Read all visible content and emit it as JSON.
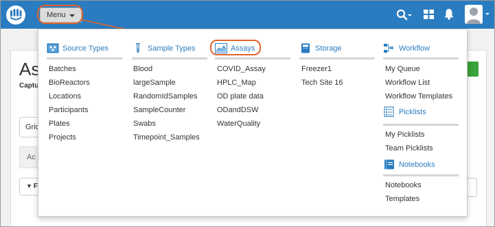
{
  "topbar": {
    "menu_label": "Menu"
  },
  "background": {
    "title_fragment": "As",
    "subtitle_fragment": "Captu",
    "input_fragment": "Grid",
    "tab_fragment": "Ac",
    "filter_fragment": "F"
  },
  "menu": {
    "columns": [
      {
        "header": "Source Types",
        "icon": "source-types-icon",
        "items": [
          "Batches",
          "BioReactors",
          "Locations",
          "Participants",
          "Plates",
          "Projects"
        ]
      },
      {
        "header": "Sample Types",
        "icon": "test-tube-icon",
        "items": [
          "Blood",
          "largeSample",
          "RandomIdSamples",
          "SampleCounter",
          "Swabs",
          "Timepoint_Samples"
        ]
      },
      {
        "header": "Assays",
        "icon": "assay-chart-icon",
        "items": [
          "COVID_Assay",
          "HPLC_Map",
          "OD plate data",
          "ODandDSW",
          "WaterQuality"
        ]
      },
      {
        "header": "Storage",
        "icon": "storage-book-icon",
        "items": [
          "Freezer1",
          "Tech Site 16"
        ]
      },
      {
        "header": "Workflow",
        "icon": "workflow-icon",
        "items": [
          "My Queue",
          "Workflow List",
          "Workflow Templates"
        ]
      }
    ],
    "picklists": {
      "header": "Picklists",
      "icon": "picklist-icon",
      "items": [
        "My Picklists",
        "Team Picklists"
      ]
    },
    "notebooks": {
      "header": "Notebooks",
      "icon": "notebook-icon",
      "items": [
        "Notebooks",
        "Templates"
      ]
    }
  },
  "colors": {
    "topbar": "#2a7cc0",
    "link": "#2a7cc0",
    "highlight": "#e2642b",
    "green_button": "#3aa23a"
  }
}
